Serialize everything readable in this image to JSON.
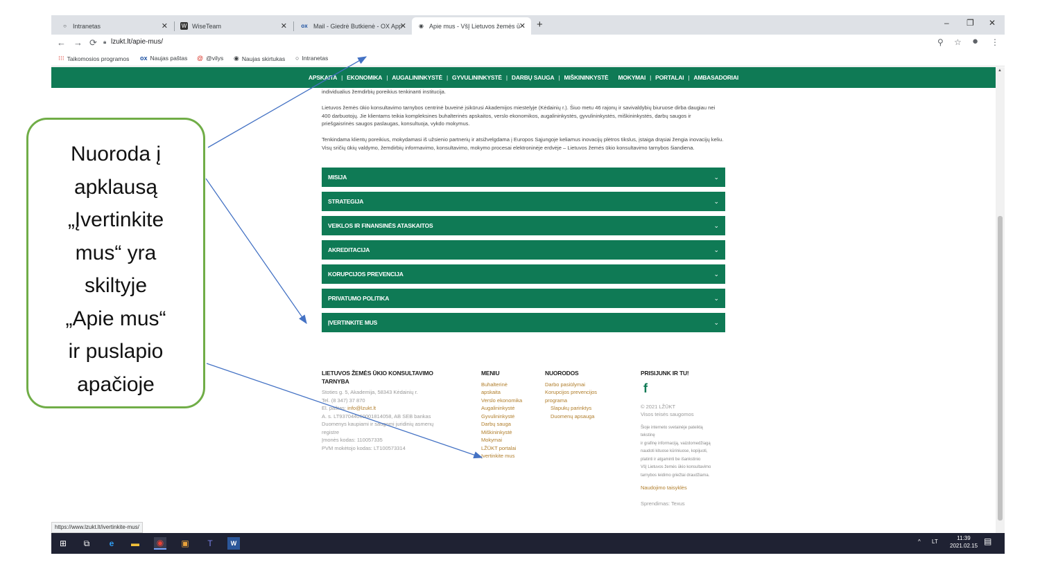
{
  "browser": {
    "tabs": [
      {
        "icon": "globe-icon",
        "title": "Intranetas"
      },
      {
        "icon": "wiseteam-icon",
        "title": "WiseTeam"
      },
      {
        "icon": "ox-icon",
        "title": "Mail - Giedrė Butkienė - OX App"
      },
      {
        "icon": "globe-icon",
        "title": "Apie mus - VšĮ Lietuvos žemės ū"
      }
    ],
    "url": "lzukt.lt/apie-mus/",
    "bookmarks": [
      {
        "icon": "apps-icon",
        "label": "Taikomosios programos"
      },
      {
        "icon": "ox-icon",
        "label": "Naujas paštas"
      },
      {
        "icon": "at-icon",
        "label": "@vilys"
      },
      {
        "icon": "globe-icon",
        "label": "Naujas skirtukas"
      },
      {
        "icon": "globe-icon",
        "label": "Intranetas"
      }
    ],
    "status_url": "https://www.lzukt.lt/ivertinkite-mus/"
  },
  "site": {
    "nav": [
      "APSKAITA",
      "EKONOMIKA",
      "AUGALININKYSTĖ",
      "GYVULININKYSTĖ",
      "DARBŲ SAUGA",
      "MIŠKININKYSTĖ",
      "MOKYMAI",
      "PORTALAI",
      "AMBASADORIAI"
    ],
    "paragraphs": [
      "individualius žemdirbių poreikius tenkinanti institucija.",
      "Lietuvos žemės ūkio konsultavimo tarnybos centrinė buveinė įsikūrusi Akademijos miestelyje (Kėdainių r.). Šiuo metu 46 rajonų ir savivaldybių biuruose dirba daugiau nei 400 darbuotojų. Jie klientams teikia kompleksines buhalterinės apskaitos, verslo ekonomikos, augalininkystės, gyvulininkystės, miškininkystės, darbų saugos ir priešgaisrinės saugos paslaugas, konsultuoja, vykdo mokymus.",
      "Tenkindama klientų poreikius, mokydamasi iš užsienio partnerių ir atsižvelgdama į Europos Sąjungoje keliamus inovacijų plėtros tikslus, įstaiga drąsiai žengia inovacijų keliu. Visų sričių ūkių valdymo, žemdirbių informavimo, konsultavimo, mokymo procesai elektroninėje erdvėje – Lietuvos žemės ūkio konsultavimo tarnybos šiandiena."
    ],
    "accordions": [
      "MISIJA",
      "STRATEGIJA",
      "VEIKLOS IR FINANSINĖS ATASKAITOS",
      "AKREDITACIJA",
      "KORUPCIJOS PREVENCIJA",
      "PRIVATUMO POLITIKA",
      "ĮVERTINKITE MUS"
    ],
    "footer": {
      "org_title": "LIETUVOS ŽEMĖS ŪKIO KONSULTAVIMO TARNYBA",
      "org_lines": [
        "Stoties g. 5, Akademija, 58343 Kėdainių r.",
        "Tel. (8 347) 37 870",
        "El. paštas: info@lzukt.lt",
        "A. s. LT937044060001814058, AB SEB bankas",
        "Duomenys kaupiami ir saugomi juridinių asmenų",
        "registre",
        "Įmonės kodas: 110057335",
        "PVM mokėtojo kodas: LT100573314"
      ],
      "menu_title": "MENIU",
      "menu_items": [
        "Buhalterinė",
        "apskaita",
        "Verslo ekonomika",
        "Augalininkystė",
        "Gyvulininkystė",
        "Darbų sauga",
        "Miškininkystė",
        "Mokymai",
        "LŽŪKT portalai",
        "Įvertinkite mus"
      ],
      "links_title": "NUORODOS",
      "links_items": [
        "Darbo pasiūlymai",
        "Korupcijos prevencijos",
        "programa"
      ],
      "links_sub": [
        "Slapukų parinktys",
        "Duomenų apsauga"
      ],
      "social_title": "PRISIJUNK IR TU!",
      "social_icon": "facebook-icon",
      "copyright": "© 2021 LŽŪKT",
      "rights": "Visos teisės saugomos",
      "legal": [
        "Šioje interneto svetainėje pateiktą",
        "tekstinę",
        "ir grafinę informaciją, vaizdomedžiagą",
        "naudoti kituose kūriniuose, kopijuoti,",
        "platinti ir atgaminti be išankstinio",
        "VšĮ Lietuvos žemės ūkio konsultavimo",
        "tarnybos leidimo griežtai draudžiama."
      ],
      "terms": "Naudojimo taisyklės",
      "solution": "Sprendimas: Texus"
    }
  },
  "taskbar": {
    "lang": "LT",
    "time": "11:39",
    "date": "2021.02.15"
  },
  "callout": {
    "lines": [
      "Nuoroda į",
      "apklausą",
      "„Įvertinkite",
      "mus“  yra",
      "skiltyje",
      "„Apie mus“",
      "ir puslapio",
      "apačioje"
    ],
    "border_color": "#70ad47",
    "arrow_color": "#4472c4"
  },
  "colors": {
    "site_green": "#0f7a55",
    "link_gold": "#b07d2a"
  }
}
